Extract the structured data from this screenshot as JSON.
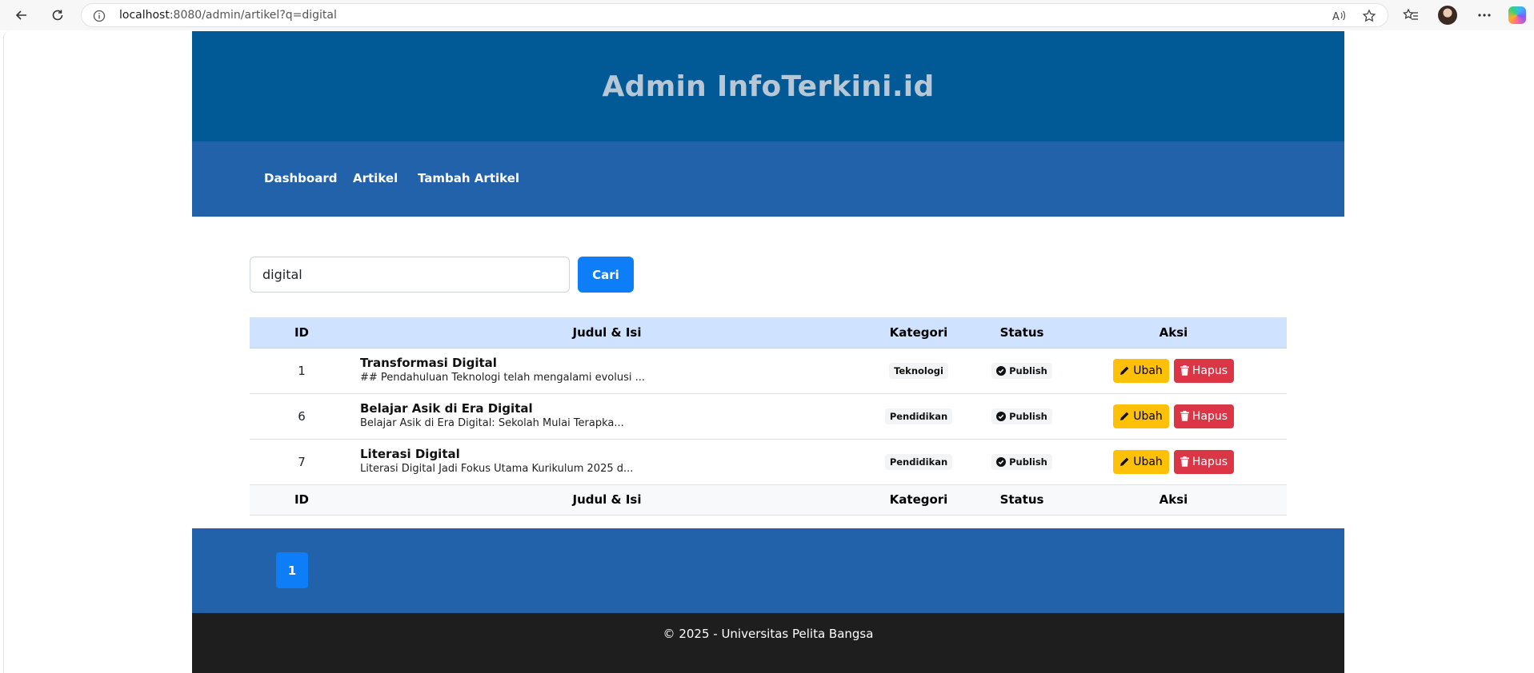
{
  "browser": {
    "url_host": "localhost",
    "url_rest": ":8080/admin/artikel?q=digital"
  },
  "site": {
    "title": "Admin InfoTerkini.id",
    "nav": [
      "Dashboard",
      "Artikel",
      "Tambah Artikel"
    ]
  },
  "search": {
    "value": "digital",
    "button_label": "Cari"
  },
  "table": {
    "headers": [
      "ID",
      "Judul & Isi",
      "Kategori",
      "Status",
      "Aksi"
    ],
    "rows": [
      {
        "id": "1",
        "title": "Transformasi Digital",
        "excerpt": "## Pendahuluan Teknologi telah mengalami evolusi ...",
        "category": "Teknologi",
        "status": "Publish"
      },
      {
        "id": "6",
        "title": "Belajar Asik di Era Digital",
        "excerpt": "Belajar Asik di Era Digital: Sekolah Mulai Terapka...",
        "category": "Pendidikan",
        "status": "Publish"
      },
      {
        "id": "7",
        "title": "Literasi Digital",
        "excerpt": "Literasi Digital Jadi Fokus Utama Kurikulum 2025 d...",
        "category": "Pendidikan",
        "status": "Publish"
      }
    ],
    "edit_label": "Ubah",
    "delete_label": "Hapus"
  },
  "pagination": {
    "current": "1"
  },
  "footer": {
    "text": "© 2025 - Universitas Pelita Bangsa"
  },
  "colors": {
    "header": "#015a96",
    "nav": "#2162ab",
    "primary": "#0d7ef7",
    "warning": "#ffc107",
    "danger": "#dc3545",
    "footer": "#1e1e1e"
  }
}
